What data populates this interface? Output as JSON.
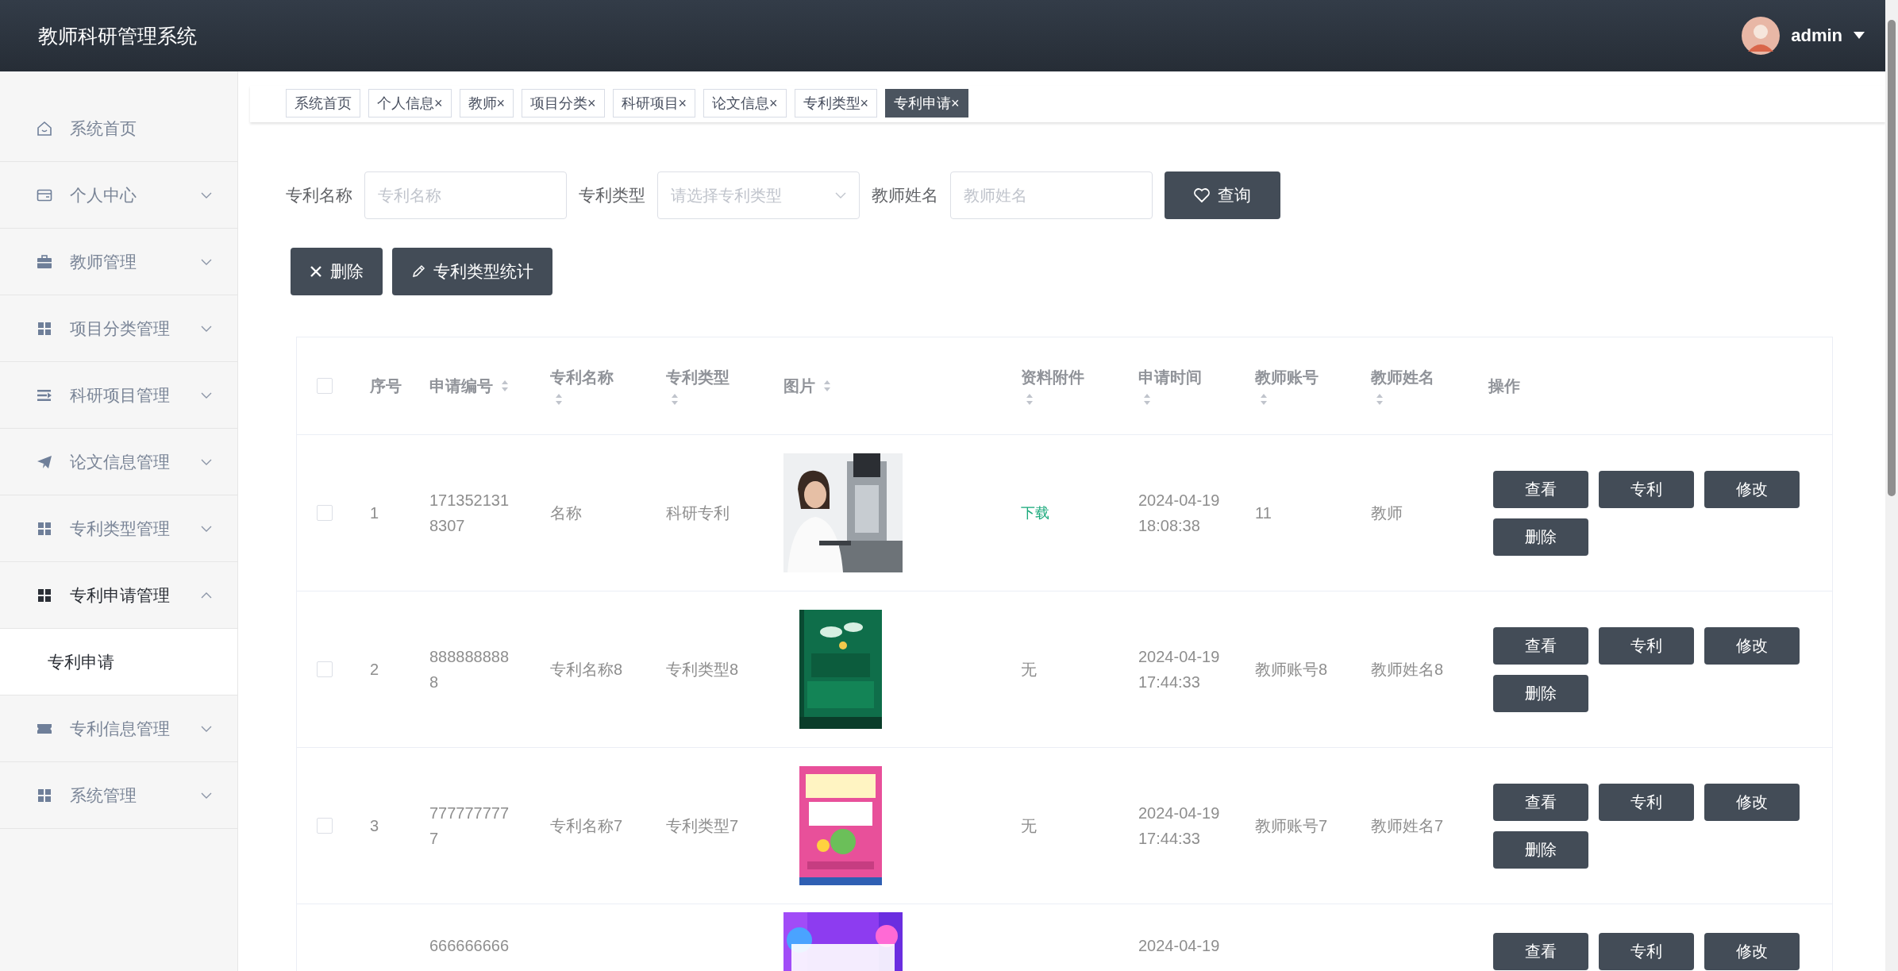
{
  "app_title": "教师科研管理系统",
  "user": {
    "name": "admin"
  },
  "sidebar": {
    "items": [
      {
        "label": "系统首页",
        "kind": "link",
        "selected": false
      },
      {
        "label": "个人中心",
        "kind": "menu",
        "expanded": false,
        "selected": false
      },
      {
        "label": "教师管理",
        "kind": "menu",
        "expanded": false,
        "selected": false
      },
      {
        "label": "项目分类管理",
        "kind": "menu",
        "expanded": false,
        "selected": false
      },
      {
        "label": "科研项目管理",
        "kind": "menu",
        "expanded": false,
        "selected": false
      },
      {
        "label": "论文信息管理",
        "kind": "menu",
        "expanded": false,
        "selected": false
      },
      {
        "label": "专利类型管理",
        "kind": "menu",
        "expanded": false,
        "selected": false
      },
      {
        "label": "专利申请管理",
        "kind": "menu",
        "expanded": true,
        "selected": true,
        "children": [
          {
            "label": "专利申请",
            "selected": true
          }
        ]
      },
      {
        "label": "专利信息管理",
        "kind": "menu",
        "expanded": false,
        "selected": false
      },
      {
        "label": "系统管理",
        "kind": "menu",
        "expanded": false,
        "selected": false
      }
    ]
  },
  "tabs": [
    {
      "label": "系统首页",
      "selected": false
    },
    {
      "label": "个人信息",
      "close": "×",
      "selected": false
    },
    {
      "label": "教师",
      "close": "×",
      "selected": false
    },
    {
      "label": "项目分类",
      "close": "×",
      "selected": false
    },
    {
      "label": "科研项目",
      "close": "×",
      "selected": false
    },
    {
      "label": "论文信息",
      "close": "×",
      "selected": false
    },
    {
      "label": "专利类型",
      "close": "×",
      "selected": false
    },
    {
      "label": "专利申请",
      "close": "×",
      "selected": true
    }
  ],
  "search": {
    "fields": [
      {
        "label": "专利名称",
        "kind": "input",
        "placeholder": "专利名称"
      },
      {
        "label": "专利类型",
        "kind": "select",
        "placeholder": "请选择专利类型"
      },
      {
        "label": "教师姓名",
        "kind": "input",
        "placeholder": "教师姓名"
      }
    ],
    "button": "查询"
  },
  "toolbar": {
    "buttons": [
      "删除",
      "专利类型统计"
    ]
  },
  "table": {
    "columns": [
      {
        "kind": "checkbox",
        "checked": false
      },
      {
        "kind": "text",
        "label": "序号",
        "sortable": false
      },
      {
        "kind": "text",
        "label": "申请编号",
        "sortable": true
      },
      {
        "kind": "text",
        "label": "专利名称",
        "sortable": true
      },
      {
        "kind": "text",
        "label": "专利类型",
        "sortable": true
      },
      {
        "kind": "text",
        "label": "图片",
        "sortable": true
      },
      {
        "kind": "text",
        "label": "资料附件",
        "sortable": true
      },
      {
        "kind": "text",
        "label": "申请时间",
        "sortable": true
      },
      {
        "kind": "text",
        "label": "教师账号",
        "sortable": true
      },
      {
        "kind": "text",
        "label": "教师姓名",
        "sortable": true
      },
      {
        "kind": "text",
        "label": "操作",
        "sortable": false
      }
    ],
    "rows": [
      {
        "kind": "full",
        "checked": false,
        "index": "1",
        "number": "1713521318307",
        "name": "名称",
        "type": "科研专利",
        "picture": {
          "kind": "picture"
        },
        "attachment": {
          "kind": "link",
          "text": "下载"
        },
        "time": "2024-04-19 18:08:38",
        "account": "11",
        "teacher": "教师",
        "actions": [
          "查看",
          "专利",
          "修改",
          "删除"
        ]
      },
      {
        "kind": "full",
        "checked": false,
        "index": "2",
        "number": "8888888888",
        "name": "专利名称8",
        "type": "专利类型8",
        "picture": {
          "kind": "picture"
        },
        "attachment": {
          "kind": "text",
          "text": "无"
        },
        "time": "2024-04-19 17:44:33",
        "account": "教师账号8",
        "teacher": "教师姓名8",
        "actions": [
          "查看",
          "专利",
          "修改",
          "删除"
        ]
      },
      {
        "kind": "full",
        "checked": false,
        "index": "3",
        "number": "7777777777",
        "name": "专利名称7",
        "type": "专利类型7",
        "picture": {
          "kind": "picture"
        },
        "attachment": {
          "kind": "text",
          "text": "无"
        },
        "time": "2024-04-19 17:44:33",
        "account": "教师账号7",
        "teacher": "教师姓名7",
        "actions": [
          "查看",
          "专利",
          "修改",
          "删除"
        ]
      },
      {
        "kind": "partial",
        "number": "666666666",
        "picture": {
          "kind": "picture"
        },
        "time": "2024-04-19",
        "actions": [
          "查看",
          "专利",
          "修改"
        ]
      }
    ]
  }
}
